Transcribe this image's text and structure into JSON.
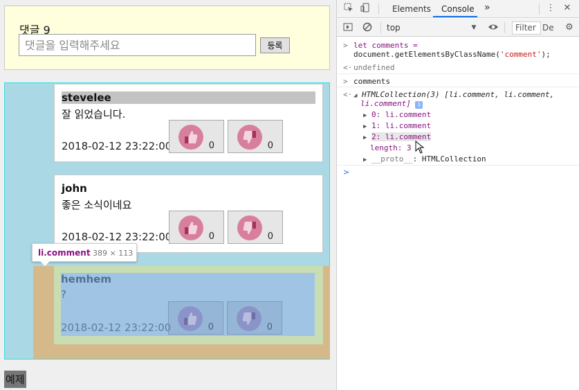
{
  "page": {
    "comment_count": "댓글 9",
    "input_placeholder": "댓글을 입력해주세요",
    "submit_label": "등록",
    "example_label": "예제",
    "comments": [
      {
        "author": "stevelee",
        "body": "잘 읽었습니다.",
        "time": "2018-02-12 23:22:00",
        "likes": "0",
        "dislikes": "0"
      },
      {
        "author": "john",
        "body": "좋은 소식이네요",
        "time": "2018-02-12 23:22:00",
        "likes": "0",
        "dislikes": "0"
      },
      {
        "author": "hemhem",
        "body": "?",
        "time": "2018-02-12 23:22:00",
        "likes": "0",
        "dislikes": "0"
      }
    ],
    "tooltip": {
      "tag": "li.comment",
      "size": "389 × 113"
    }
  },
  "devtools": {
    "tabs": [
      "Elements",
      "Console"
    ],
    "more": "»",
    "context": "top",
    "filter_placeholder": "Filter",
    "levels": "De",
    "console": {
      "line1_a": "let comments =",
      "line1_b": "document.getElementsByClassName(",
      "line1_str": "'comment'",
      "line1_end": ");",
      "result1": "undefined",
      "input2": "comments",
      "collection_head": "HTMLCollection(3) [li.comment, li.comment,",
      "collection_head2": "li.comment]",
      "items": [
        "0: li.comment",
        "1: li.comment",
        "2: li.comment"
      ],
      "length": "length: 3",
      "proto_key": "__proto__",
      "proto_val": ": HTMLCollection"
    }
  },
  "colors": {
    "comment_box_bg": "#ffffdd",
    "list_bg": "#aad8e4",
    "vote_bubble": "#d97f9e",
    "console_accent": "#1a73e8"
  }
}
